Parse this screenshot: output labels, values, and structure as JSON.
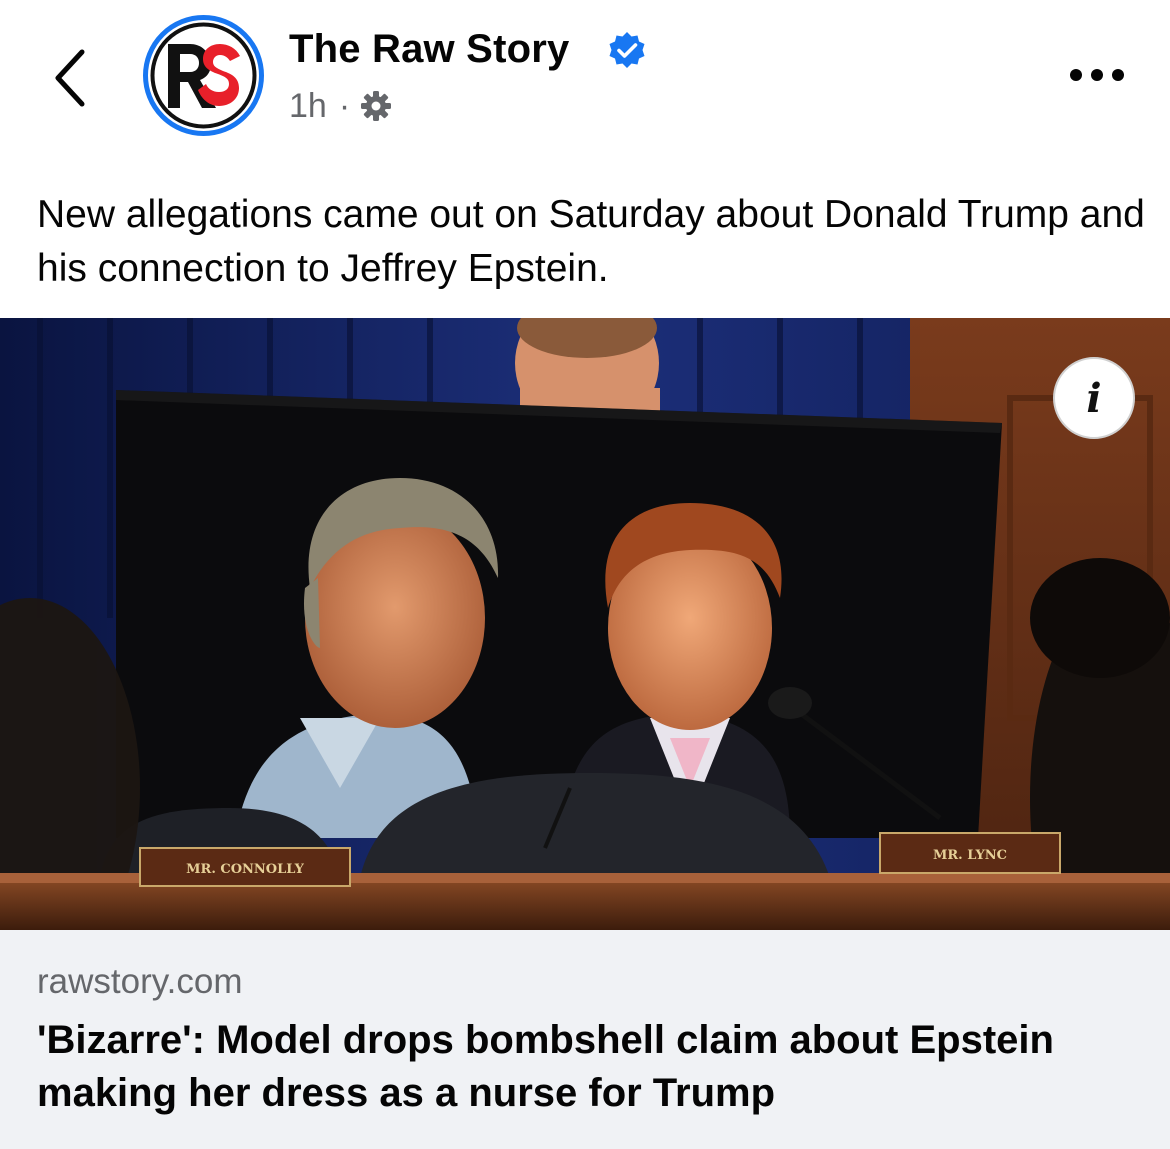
{
  "header": {
    "page_name": "The Raw Story",
    "timestamp": "1h",
    "separator": "·",
    "avatar_icon": "raw-story-logo",
    "verified_icon": "verified-badge-icon",
    "privacy_icon": "gear-icon",
    "back_icon": "chevron-left-icon",
    "more_icon": "more-dots-icon"
  },
  "post": {
    "caption": "New allegations came out on Saturday about Donald Trump and his connection to Jeffrey Epstein."
  },
  "image": {
    "info_icon": "info-icon",
    "info_label": "i",
    "nameplates": [
      "MR. CONNOLLY",
      "MR. LYNC"
    ]
  },
  "link_preview": {
    "domain": "rawstory.com",
    "headline": "'Bizarre': Model drops bombshell claim about Epstein making her dress as a nurse for Trump"
  },
  "colors": {
    "accent": "#1877f2",
    "secondary_text": "#65676b",
    "card_background": "#f0f2f5",
    "logo_red": "#e8202a"
  }
}
